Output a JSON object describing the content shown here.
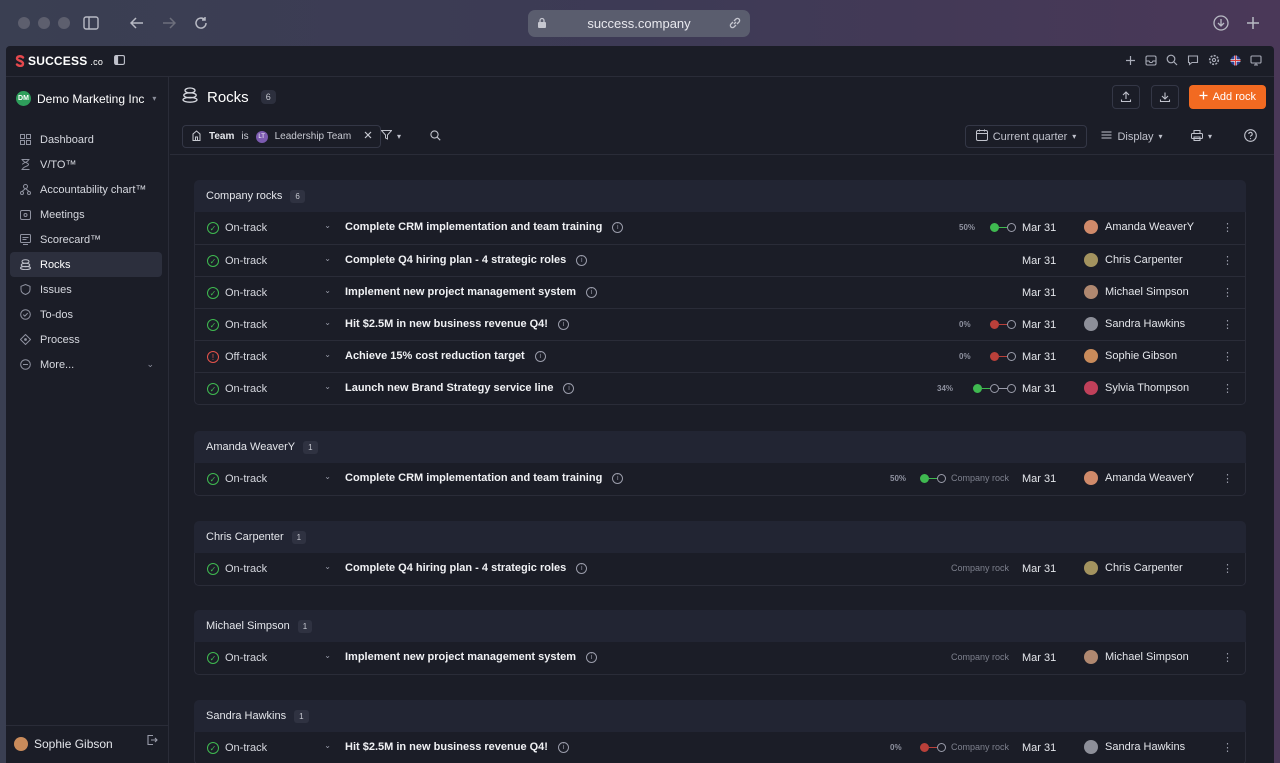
{
  "browser": {
    "url": "success.company"
  },
  "app": {
    "logo": "SUCCESS",
    "logo_suffix": ".co"
  },
  "sidebar": {
    "org_initials": "DM",
    "org_name": "Demo Marketing Inc",
    "items": [
      {
        "label": "Dashboard",
        "icon": "grid-icon"
      },
      {
        "label": "V/TO™",
        "icon": "hourglass-icon"
      },
      {
        "label": "Accountability chart™",
        "icon": "org-chart-icon"
      },
      {
        "label": "Meetings",
        "icon": "calendar-icon"
      },
      {
        "label": "Scorecard™",
        "icon": "scorecard-icon"
      },
      {
        "label": "Rocks",
        "icon": "rocks-icon"
      },
      {
        "label": "Issues",
        "icon": "shield-icon"
      },
      {
        "label": "To-dos",
        "icon": "check-circle-icon"
      },
      {
        "label": "Process",
        "icon": "process-icon"
      },
      {
        "label": "More...",
        "icon": "minus-circle-icon"
      }
    ],
    "user_name": "Sophie Gibson"
  },
  "header": {
    "title": "Rocks",
    "count": "6",
    "add_label": "Add rock"
  },
  "filters": {
    "team_key": "Team",
    "team_op": "is",
    "team_initials": "LT",
    "team_value": "Leadership Team",
    "period": "Current quarter",
    "display": "Display"
  },
  "groups": [
    {
      "title": "Company rocks",
      "count": "6",
      "rows": [
        {
          "status": "On-track",
          "title": "Complete CRM implementation and team training",
          "pct": "50%",
          "progress": 0.5,
          "due": "Mar 31",
          "owner": "Amanda WeaverY"
        },
        {
          "status": "On-track",
          "title": "Complete Q4 hiring plan - 4 strategic roles",
          "pct": "",
          "due": "Mar 31",
          "owner": "Chris Carpenter"
        },
        {
          "status": "On-track",
          "title": "Implement new project management system",
          "pct": "",
          "due": "Mar 31",
          "owner": "Michael Simpson"
        },
        {
          "status": "On-track",
          "title": "Hit $2.5M in new business revenue Q4!",
          "pct": "0%",
          "progress": 0,
          "due": "Mar 31",
          "owner": "Sandra Hawkins"
        },
        {
          "status": "Off-track",
          "title": "Achieve 15% cost reduction target",
          "pct": "0%",
          "progress": 0,
          "due": "Mar 31",
          "owner": "Sophie Gibson"
        },
        {
          "status": "On-track",
          "title": "Launch new Brand Strategy service line",
          "pct": "34%",
          "progress": 0.34,
          "due": "Mar 31",
          "owner": "Sylvia Thompson"
        }
      ]
    },
    {
      "title": "Amanda WeaverY",
      "count": "1",
      "rows": [
        {
          "status": "On-track",
          "title": "Complete CRM implementation and team training",
          "pct": "50%",
          "progress": 0.5,
          "tag": "Company rock",
          "due": "Mar 31",
          "owner": "Amanda WeaverY"
        }
      ]
    },
    {
      "title": "Chris Carpenter",
      "count": "1",
      "rows": [
        {
          "status": "On-track",
          "title": "Complete Q4 hiring plan - 4 strategic roles",
          "tag": "Company rock",
          "due": "Mar 31",
          "owner": "Chris Carpenter"
        }
      ]
    },
    {
      "title": "Michael Simpson",
      "count": "1",
      "rows": [
        {
          "status": "On-track",
          "title": "Implement new project management system",
          "tag": "Company rock",
          "due": "Mar 31",
          "owner": "Michael Simpson"
        }
      ]
    },
    {
      "title": "Sandra Hawkins",
      "count": "1",
      "rows": [
        {
          "status": "On-track",
          "title": "Hit $2.5M in new business revenue Q4!",
          "pct": "0%",
          "progress": 0,
          "tag": "Company rock",
          "due": "Mar 31",
          "owner": "Sandra Hawkins"
        }
      ]
    }
  ],
  "colors": {
    "accent": "#f26a21",
    "on_track": "#3fb950",
    "off_track": "#e5534b"
  }
}
